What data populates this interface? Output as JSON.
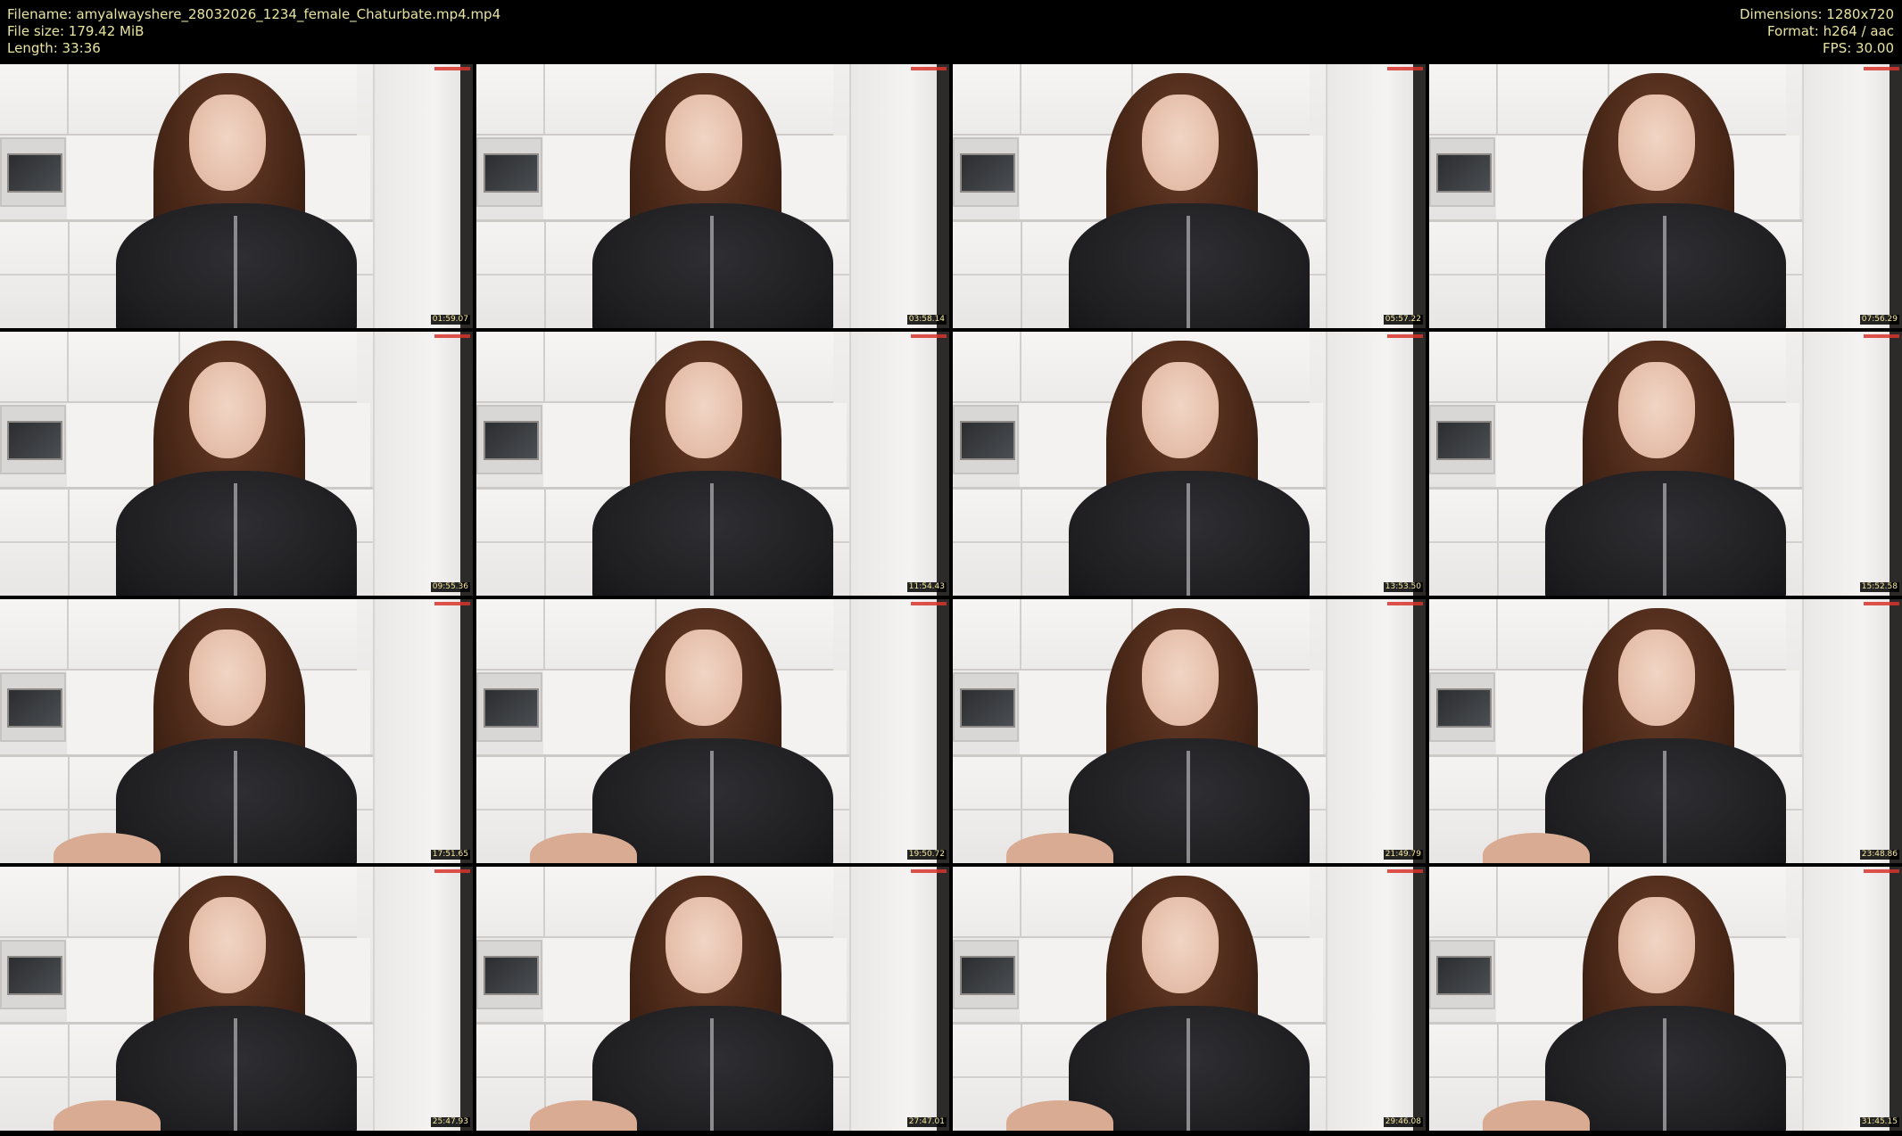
{
  "header": {
    "filename_label": "Filename: amyalwayshere_28032026_1234_female_Chaturbate.mp4.mp4",
    "filesize_label": "File size: 179.42 MiB",
    "length_label": "Length: 33:36",
    "dimensions_label": "Dimensions: 1280x720",
    "format_label": "Format: h264 / aac",
    "fps_label": "FPS: 30.00"
  },
  "thumbnails": [
    {
      "time": "01:59.07"
    },
    {
      "time": "03:58.14"
    },
    {
      "time": "05:57.22"
    },
    {
      "time": "07:56.29"
    },
    {
      "time": "09:55.36"
    },
    {
      "time": "11:54.43"
    },
    {
      "time": "13:53.50"
    },
    {
      "time": "15:52.58"
    },
    {
      "time": "17:51.65"
    },
    {
      "time": "19:50.72"
    },
    {
      "time": "21:49.79"
    },
    {
      "time": "23:48.86"
    },
    {
      "time": "25:47.93"
    },
    {
      "time": "27:47.01"
    },
    {
      "time": "29:46.08"
    },
    {
      "time": "31:45.15"
    }
  ],
  "colors": {
    "header_text": "#e8e4a0",
    "background": "#000000",
    "timestamp_text": "#f5e8a0",
    "watermark": "#d9342b"
  }
}
